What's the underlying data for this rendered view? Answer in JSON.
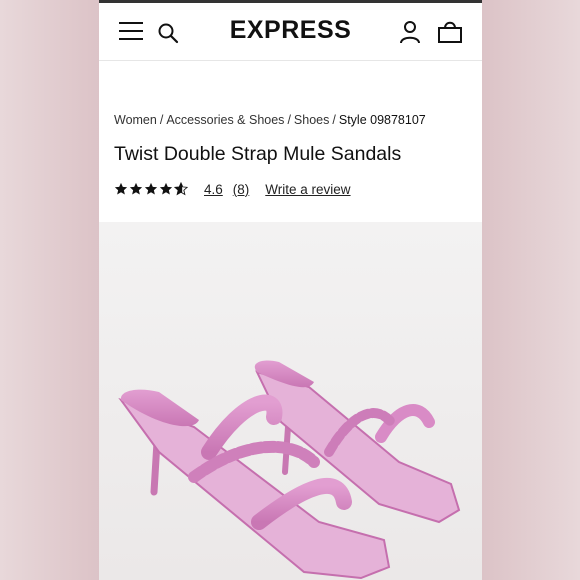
{
  "colors": {
    "accent_text": "#111111",
    "sandal_pink": "#d58ac3",
    "background_blur": "#e3cfd2"
  },
  "header": {
    "brand": "EXPRESS",
    "icons": [
      "menu-icon",
      "search-icon",
      "account-icon",
      "shopping-bag-icon"
    ]
  },
  "breadcrumb": {
    "items": [
      "Women",
      "Accessories & Shoes",
      "Shoes"
    ],
    "style": "Style 09878107"
  },
  "product": {
    "title": "Twist Double Strap Mule Sandals",
    "rating_stars": 4.6,
    "rating_value": "4.6",
    "review_count": "(8)",
    "write_review": "Write a review"
  }
}
